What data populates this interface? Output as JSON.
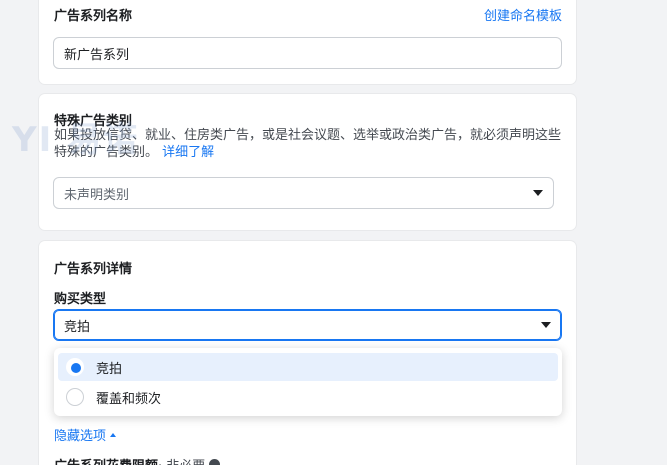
{
  "campaign_name": {
    "title": "广告系列名称",
    "template_link": "创建命名模板",
    "value": "新广告系列"
  },
  "special_category": {
    "title": "特殊广告类别",
    "description": "如果投放信贷、就业、住房类广告，或是社会议题、选举或政治类广告，就必须声明这些特殊的广告类别。",
    "learn_more": "详细了解",
    "select_placeholder": "未声明类别"
  },
  "campaign_details": {
    "title": "广告系列详情",
    "buying_type_label": "购买类型",
    "buying_type_value": "竞拍",
    "options": [
      {
        "label": "竞拍",
        "selected": true
      },
      {
        "label": "覆盖和频次",
        "selected": false
      }
    ],
    "hide_options": "隐藏选项",
    "spend_limit_label": "广告系列花费限额",
    "spend_limit_optional": " · 非必要"
  },
  "watermark": "YI 易诺",
  "colors": {
    "accent": "#1877f2",
    "selected_bg": "#e7f0fd",
    "page_bg": "#f2f3f5"
  }
}
